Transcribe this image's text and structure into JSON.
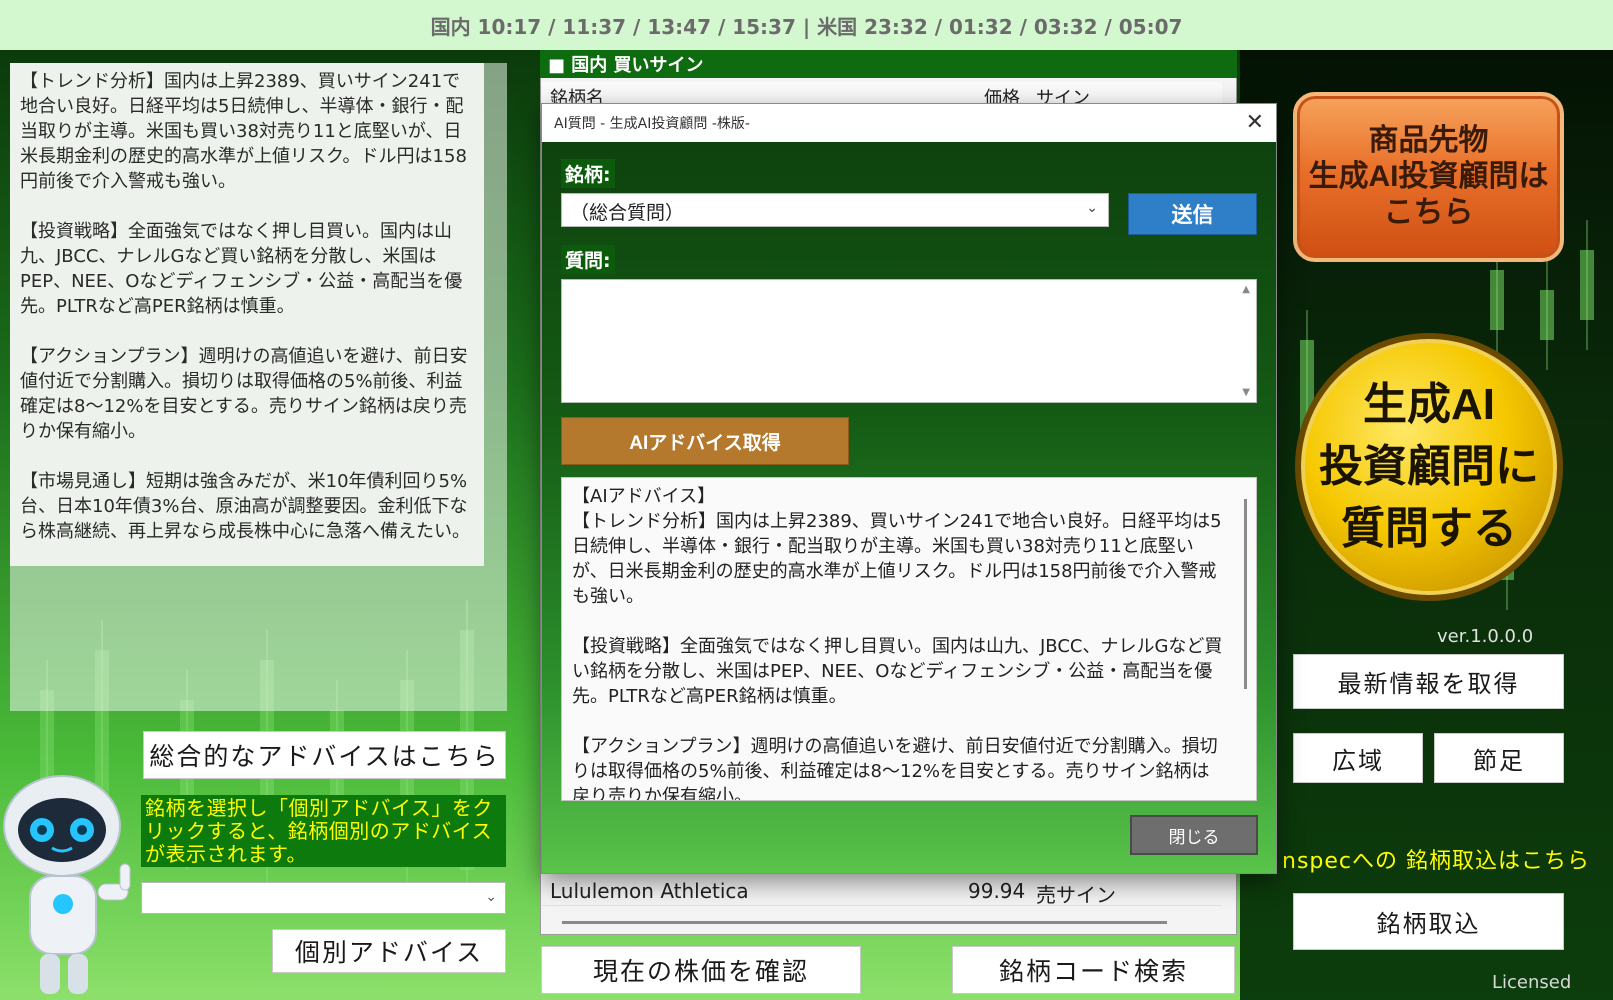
{
  "timebar": {
    "text": "国内 10:17 / 11:37 / 13:47 / 15:37  |  米国 23:32 / 01:32 / 03:32 / 05:07"
  },
  "left": {
    "analysis_text": "【トレンド分析】国内は上昇2389、買いサイン241で地合い良好。日経平均は5日続伸し、半導体・銀行・配当取りが主導。米国も買い38対売り11と底堅いが、日米長期金利の歴史的高水準が上値リスク。ドル円は158円前後で介入警戒も強い。\n\n【投資戦略】全面強気ではなく押し目買い。国内は山九、JBCC、ナレルGなど買い銘柄を分散し、米国はPEP、NEE、Oなどディフェンシブ・公益・高配当を優先。PLTRなど高PER銘柄は慎重。\n\n【アクションプラン】週明けの高値追いを避け、前日安値付近で分割購入。損切りは取得価格の5%前後、利益確定は8〜12%を目安とする。売りサイン銘柄は戻り売りか保有縮小。\n\n【市場見通し】短期は強含みだが、米10年債利回り5%台、日本10年債3%台、原油高が調整要因。金利低下なら株高継続、再上昇なら成長株中心に急落へ備えたい。",
    "overall_button": "総合的なアドバイスはこちら",
    "hint": "銘柄を選択し「個別アドバイス」をクリックすると、銘柄個別のアドバイスが表示されます。",
    "stock_select_value": "",
    "individual_button": "個別アドバイス"
  },
  "list": {
    "title": "■ 国内 買いサイン",
    "col_name": "銘柄名",
    "col_price": "価格",
    "col_sign": "サイン",
    "rows": [
      {
        "name": "Lululemon Athletica",
        "price": "99.94",
        "sign": "売サイン"
      }
    ],
    "check_price_button": "現在の株価を確認",
    "code_search_button": "銘柄コード検索"
  },
  "right": {
    "commodity_line1": "商品先物",
    "commodity_line2": "生成AI投資顧問は",
    "commodity_line3": "こちら",
    "ai_line1": "生成AI",
    "ai_line2": "投資顧問に",
    "ai_line3": "質問する",
    "version": "ver.1.0.0.0",
    "latest_button": "最新情報を取得",
    "wide_button": "広域",
    "node_button": "節足",
    "import_hint": "nspecへの 銘柄取込はこちら",
    "import_button": "銘柄取込",
    "licensed": "Licensed"
  },
  "dialog": {
    "title": "AI質問 - 生成AI投資顧問 -株版-",
    "stock_label": "銘柄:",
    "stock_value": "（総合質問）",
    "send_button": "送信",
    "question_label": "質問:",
    "question_value": "",
    "advice_button": "AIアドバイス取得",
    "answer_text": "【AIアドバイス】\n【トレンド分析】国内は上昇2389、買いサイン241で地合い良好。日経平均は5日続伸し、半導体・銀行・配当取りが主導。米国も買い38対売り11と底堅いが、日米長期金利の歴史的高水準が上値リスク。ドル円は158円前後で介入警戒も強い。\n\n【投資戦略】全面強気ではなく押し目買い。国内は山九、JBCC、ナレルGなど買い銘柄を分散し、米国はPEP、NEE、Oなどディフェンシブ・公益・高配当を優先。PLTRなど高PER銘柄は慎重。\n\n【アクションプラン】週明けの高値追いを避け、前日安値付近で分割購入。損切りは取得価格の5%前後、利益確定は8〜12%を目安とする。売りサイン銘柄は戻り売りか保有縮小。",
    "close_button": "閉じる"
  },
  "colors": {
    "timebar_bg": "#d3f7cf",
    "hint_text": "#ffff00",
    "send_button": "#2e7fc7",
    "advice_button": "#b5792d",
    "commodity_button": "#e9712b",
    "ai_circle": "#f5c800"
  }
}
